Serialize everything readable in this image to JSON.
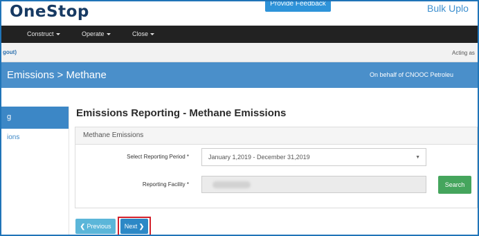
{
  "header": {
    "logo_text": "OneStop",
    "feedback_label": "Provide Feedback",
    "bulk_upload_label": "Bulk Uplo"
  },
  "nav": {
    "items": [
      {
        "label": "Construct"
      },
      {
        "label": "Operate"
      },
      {
        "label": "Close"
      }
    ]
  },
  "infobar": {
    "logout_text": "gout)",
    "acting_as_text": "Acting as"
  },
  "titlebar": {
    "breadcrumb": "Emissions > Methane",
    "on_behalf": "On behalf of CNOOC Petroleu"
  },
  "sidebar": {
    "items": [
      {
        "label": "g",
        "active": true
      },
      {
        "label": "ions",
        "active": false
      }
    ]
  },
  "main": {
    "title": "Emissions Reporting - Methane Emissions",
    "panel_heading": "Methane Emissions",
    "reporting_period_label": "Select Reporting Period *",
    "reporting_period_value": "January 1,2019 - December 31,2019",
    "reporting_facility_label": "Reporting Facility *",
    "search_label": "Search",
    "previous_label": "Previous",
    "next_label": "Next"
  },
  "colors": {
    "frame": "#1f74b8",
    "title_band": "#4a8fca",
    "search_button": "#45a55d",
    "next_button": "#2c88c6",
    "previous_button": "#5bb6d9",
    "highlight": "#d21f2a"
  }
}
